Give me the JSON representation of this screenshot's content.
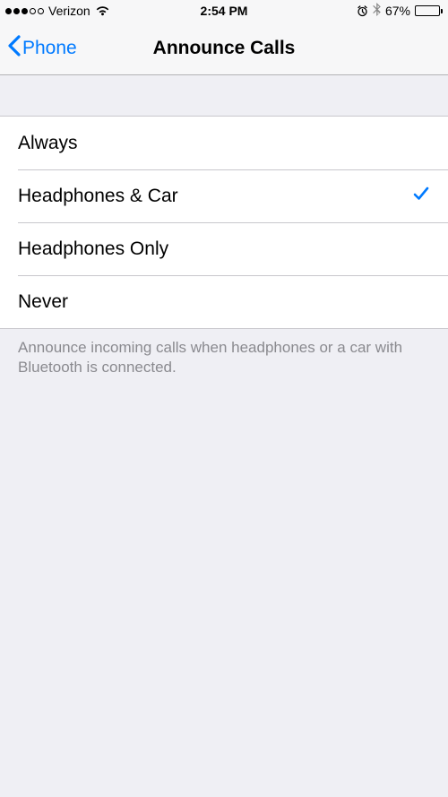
{
  "status_bar": {
    "carrier": "Verizon",
    "time": "2:54 PM",
    "battery_pct": "67%",
    "battery_level": 67
  },
  "nav": {
    "back_label": "Phone",
    "title": "Announce Calls"
  },
  "options": {
    "0": {
      "label": "Always",
      "selected": false
    },
    "1": {
      "label": "Headphones & Car",
      "selected": true
    },
    "2": {
      "label": "Headphones Only",
      "selected": false
    },
    "3": {
      "label": "Never",
      "selected": false
    }
  },
  "footer": "Announce incoming calls when headphones or a car with Bluetooth is connected."
}
